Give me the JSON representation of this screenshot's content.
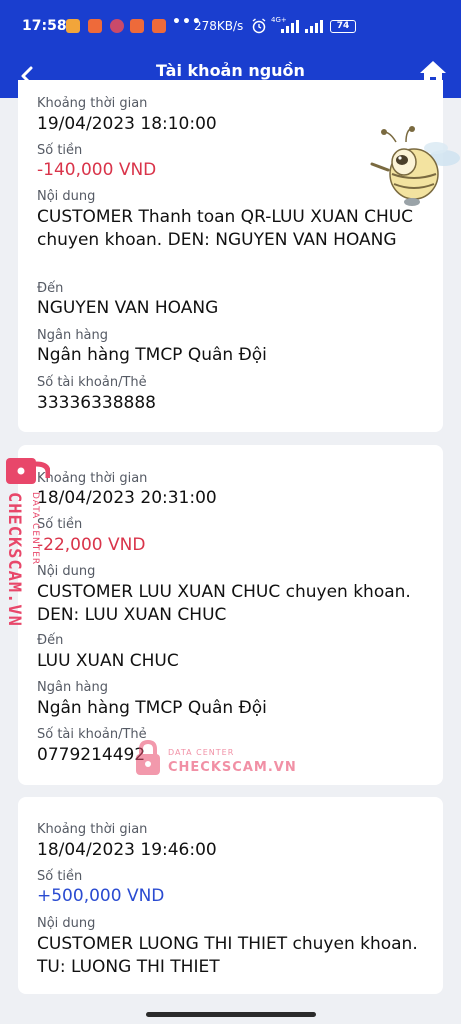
{
  "status_bar": {
    "time": "17:58",
    "dots": "•••",
    "speed": "278KB/s",
    "network": "4G+",
    "battery": "74"
  },
  "header": {
    "title": "Tài khoản nguồn"
  },
  "labels": {
    "time": "Khoảng thời gian",
    "amount": "Số tiền",
    "content": "Nội dung",
    "to": "Đến",
    "bank": "Ngân hàng",
    "account": "Số tài khoản/Thẻ"
  },
  "transactions": [
    {
      "time": "19/04/2023 18:10:00",
      "amount": "-140,000 VND",
      "content": "CUSTOMER Thanh toan QR-LUU XUAN CHUC chuyen  khoan. DEN: NGUYEN VAN HOANG",
      "to": "NGUYEN VAN HOANG",
      "bank": "Ngân hàng TMCP Quân Đội",
      "account": "33336338888"
    },
    {
      "time": "18/04/2023 20:31:00",
      "amount": "-22,000 VND",
      "content": "CUSTOMER LUU XUAN CHUC chuyen khoan. DEN: LUU XUAN CHUC",
      "to": "LUU XUAN CHUC",
      "bank": "Ngân hàng TMCP Quân Đội",
      "account": "0779214492"
    },
    {
      "time": "18/04/2023 19:46:00",
      "amount": "+500,000 VND",
      "content": "CUSTOMER LUONG THI THIET chuyen khoan. TU: LUONG THI THIET"
    }
  ],
  "watermark": {
    "brand": "CHECKSCAM.VN",
    "sub": "DATA CENTER"
  },
  "colors": {
    "header_bg": "#1a3ecf",
    "negative": "#d9344a",
    "positive": "#2a4bd1",
    "watermark": "#e8476a"
  }
}
